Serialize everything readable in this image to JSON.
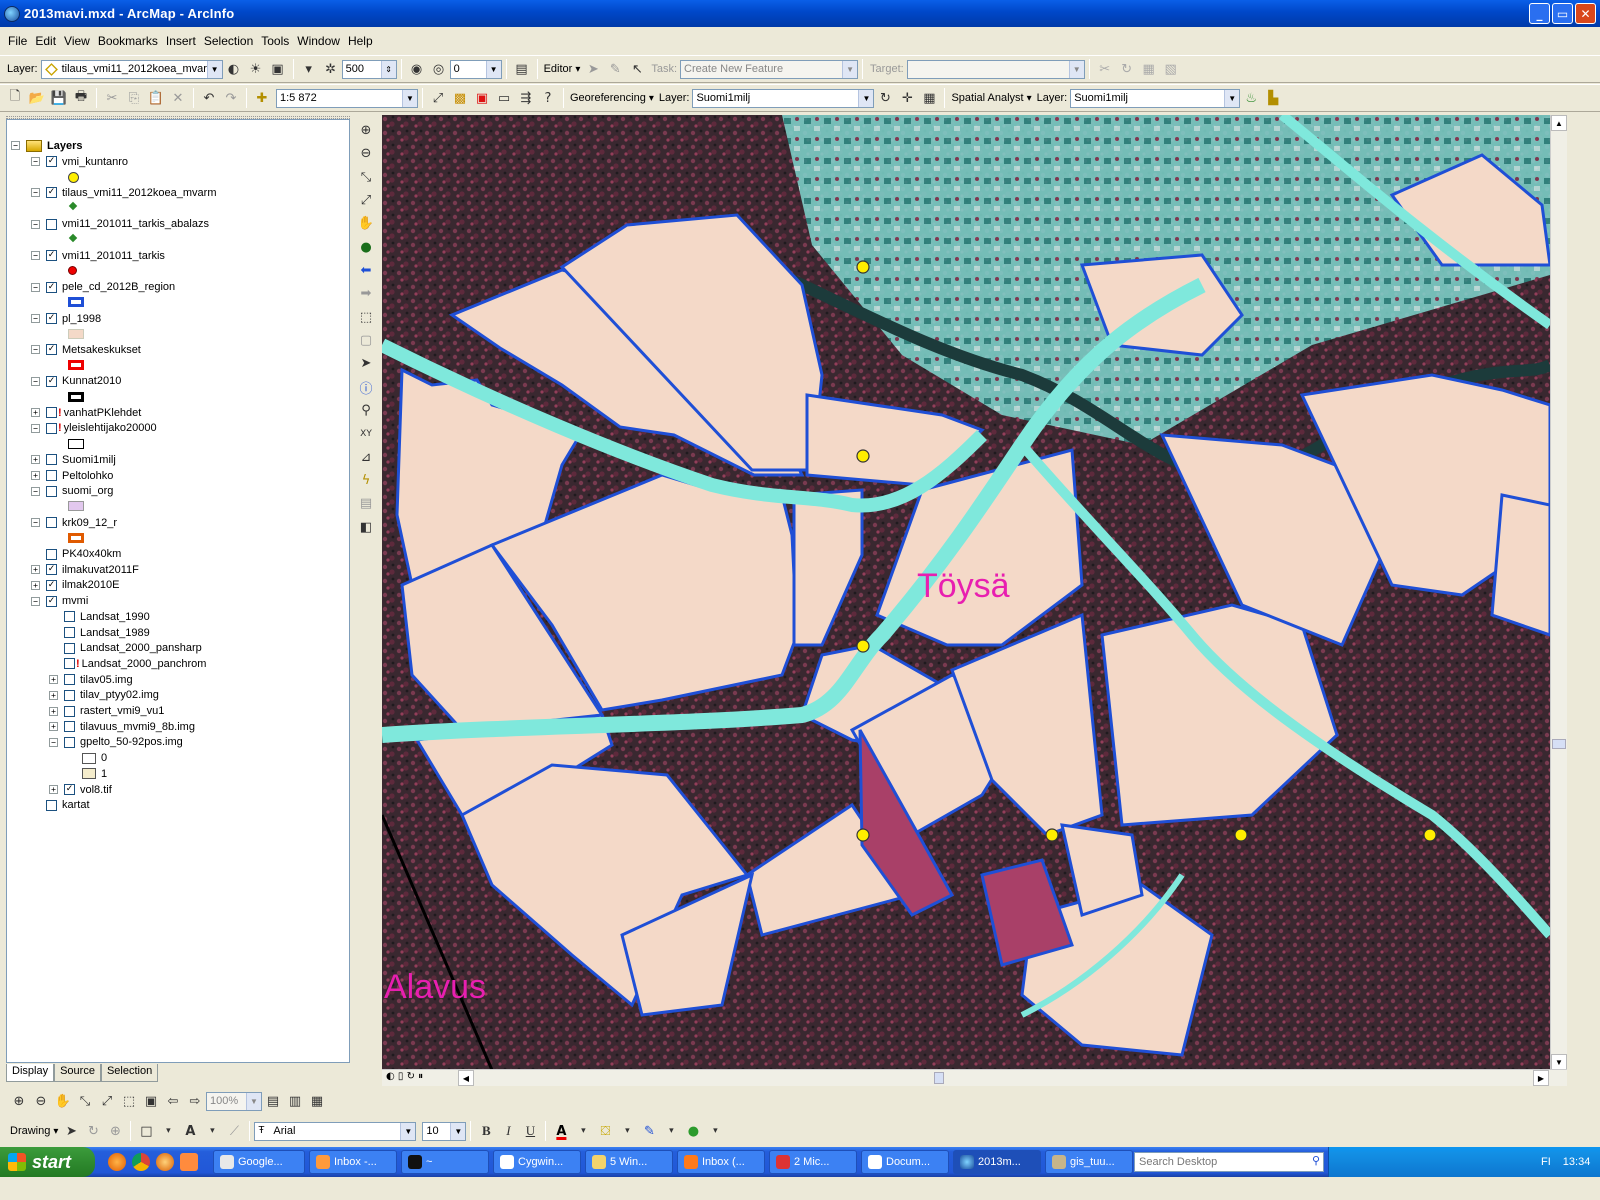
{
  "window": {
    "title": "2013mavi.mxd - ArcMap - ArcInfo",
    "min": "_",
    "max": "▭",
    "close": "✕"
  },
  "menu": [
    "File",
    "Edit",
    "View",
    "Bookmarks",
    "Insert",
    "Selection",
    "Tools",
    "Window",
    "Help"
  ],
  "toolbar1": {
    "layer_label": "Layer:",
    "layer_value": "tilaus_vmi11_2012koea_mvarm",
    "snap_value": "500",
    "offset_value": "0",
    "editor": "Editor",
    "task_label": "Task:",
    "task_value": "Create New Feature",
    "target_label": "Target:",
    "target_value": ""
  },
  "toolbar2": {
    "scale_value": "1:5 872",
    "georef": "Georeferencing",
    "layer_label": "Layer:",
    "layer_value": "Suomi1milj",
    "spatial": "Spatial Analyst",
    "layer_label2": "Layer:",
    "layer_value2": "Suomi1milj"
  },
  "toc": {
    "root": "Layers",
    "close": "×",
    "layers": [
      {
        "name": "vmi_kuntanro",
        "checked": true,
        "expand": "−",
        "indent": 0,
        "sym": "yellow-dot"
      },
      {
        "name": "tilaus_vmi11_2012koea_mvarm",
        "checked": true,
        "expand": "−",
        "indent": 0,
        "sym": "green-diamond"
      },
      {
        "name": "vmi11_201011_tarkis_abalazs",
        "checked": false,
        "expand": "−",
        "indent": 0,
        "sym": "green-diamond"
      },
      {
        "name": "vmi11_201011_tarkis",
        "checked": true,
        "expand": "−",
        "indent": 0,
        "sym": "red-dot"
      },
      {
        "name": "pele_cd_2012B_region",
        "checked": true,
        "expand": "−",
        "indent": 0,
        "sym": "blue-box"
      },
      {
        "name": "pl_1998",
        "checked": true,
        "expand": "−",
        "indent": 0,
        "sym": "pink-fill"
      },
      {
        "name": "Metsakeskukset",
        "checked": true,
        "expand": "−",
        "indent": 0,
        "sym": "red-box"
      },
      {
        "name": "Kunnat2010",
        "checked": true,
        "expand": "−",
        "indent": 0,
        "sym": "black-box"
      },
      {
        "name": "vanhatPKlehdet",
        "checked": false,
        "expand": "+",
        "indent": 0,
        "warn": true
      },
      {
        "name": "yleislehtijako20000",
        "checked": false,
        "expand": "−",
        "indent": 0,
        "warn": true,
        "sym": "white-box"
      },
      {
        "name": "Suomi1milj",
        "checked": false,
        "expand": "+",
        "indent": 0
      },
      {
        "name": "Peltolohko",
        "checked": false,
        "expand": "+",
        "indent": 0
      },
      {
        "name": "suomi_org",
        "checked": false,
        "expand": "−",
        "indent": 0,
        "sym": "lilac-fill"
      },
      {
        "name": "krk09_12_r",
        "checked": false,
        "expand": "−",
        "indent": 0,
        "sym": "orange-box"
      },
      {
        "name": "PK40x40km",
        "checked": false,
        "expand": "",
        "indent": 0
      },
      {
        "name": "ilmakuvat2011F",
        "checked": true,
        "expand": "+",
        "indent": 0
      },
      {
        "name": "ilmak2010E",
        "checked": true,
        "expand": "+",
        "indent": 0
      },
      {
        "name": "mvmi",
        "checked": true,
        "expand": "−",
        "indent": 0
      },
      {
        "name": "Landsat_1990",
        "checked": false,
        "expand": "",
        "indent": 1
      },
      {
        "name": "Landsat_1989",
        "checked": false,
        "expand": "",
        "indent": 1
      },
      {
        "name": "Landsat_2000_pansharp",
        "checked": false,
        "expand": "",
        "indent": 1
      },
      {
        "name": "Landsat_2000_panchrom",
        "checked": false,
        "expand": "",
        "indent": 1,
        "warn": true
      },
      {
        "name": "tilav05.img",
        "checked": false,
        "expand": "+",
        "indent": 1
      },
      {
        "name": "tilav_ptyy02.img",
        "checked": false,
        "expand": "+",
        "indent": 1
      },
      {
        "name": "rastert_vmi9_vu1",
        "checked": false,
        "expand": "+",
        "indent": 1
      },
      {
        "name": "tilavuus_mvmi9_8b.img",
        "checked": false,
        "expand": "+",
        "indent": 1
      },
      {
        "name": "gpelto_50-92pos.img",
        "checked": false,
        "expand": "−",
        "indent": 1
      },
      {
        "name": "0",
        "checked": null,
        "expand": "",
        "indent": 2,
        "legend": "#ffffff"
      },
      {
        "name": "1",
        "checked": null,
        "expand": "",
        "indent": 2,
        "legend": "#f5edcc"
      },
      {
        "name": "vol8.tif",
        "checked": true,
        "expand": "+",
        "indent": 1
      },
      {
        "name": "kartat",
        "checked": false,
        "expand": "",
        "indent": 0
      }
    ],
    "tabs": [
      "Display",
      "Source",
      "Selection"
    ]
  },
  "map": {
    "label_toysa": "Töysä",
    "label_alavus": "Alavus",
    "parcel_color": "#f4d9c8",
    "boundary_color": "#1f4fd6",
    "point_color": "#ffee00"
  },
  "layoutbar": {
    "zoom": "100%"
  },
  "drawbar": {
    "drawing": "Drawing",
    "font": "Arial",
    "size": "10",
    "bold": "B",
    "italic": "I",
    "underline": "U",
    "font_color": "A"
  },
  "taskbar": {
    "start": "start",
    "tasks": [
      "Google...",
      "Inbox -...",
      "~",
      "Cygwin...",
      "5 Win...",
      "Inbox (...",
      "2 Mic...",
      "Docum...",
      "2013m...",
      "gis_tuu..."
    ],
    "search": "Search Desktop",
    "lang": "FI",
    "clock": "13:34"
  }
}
